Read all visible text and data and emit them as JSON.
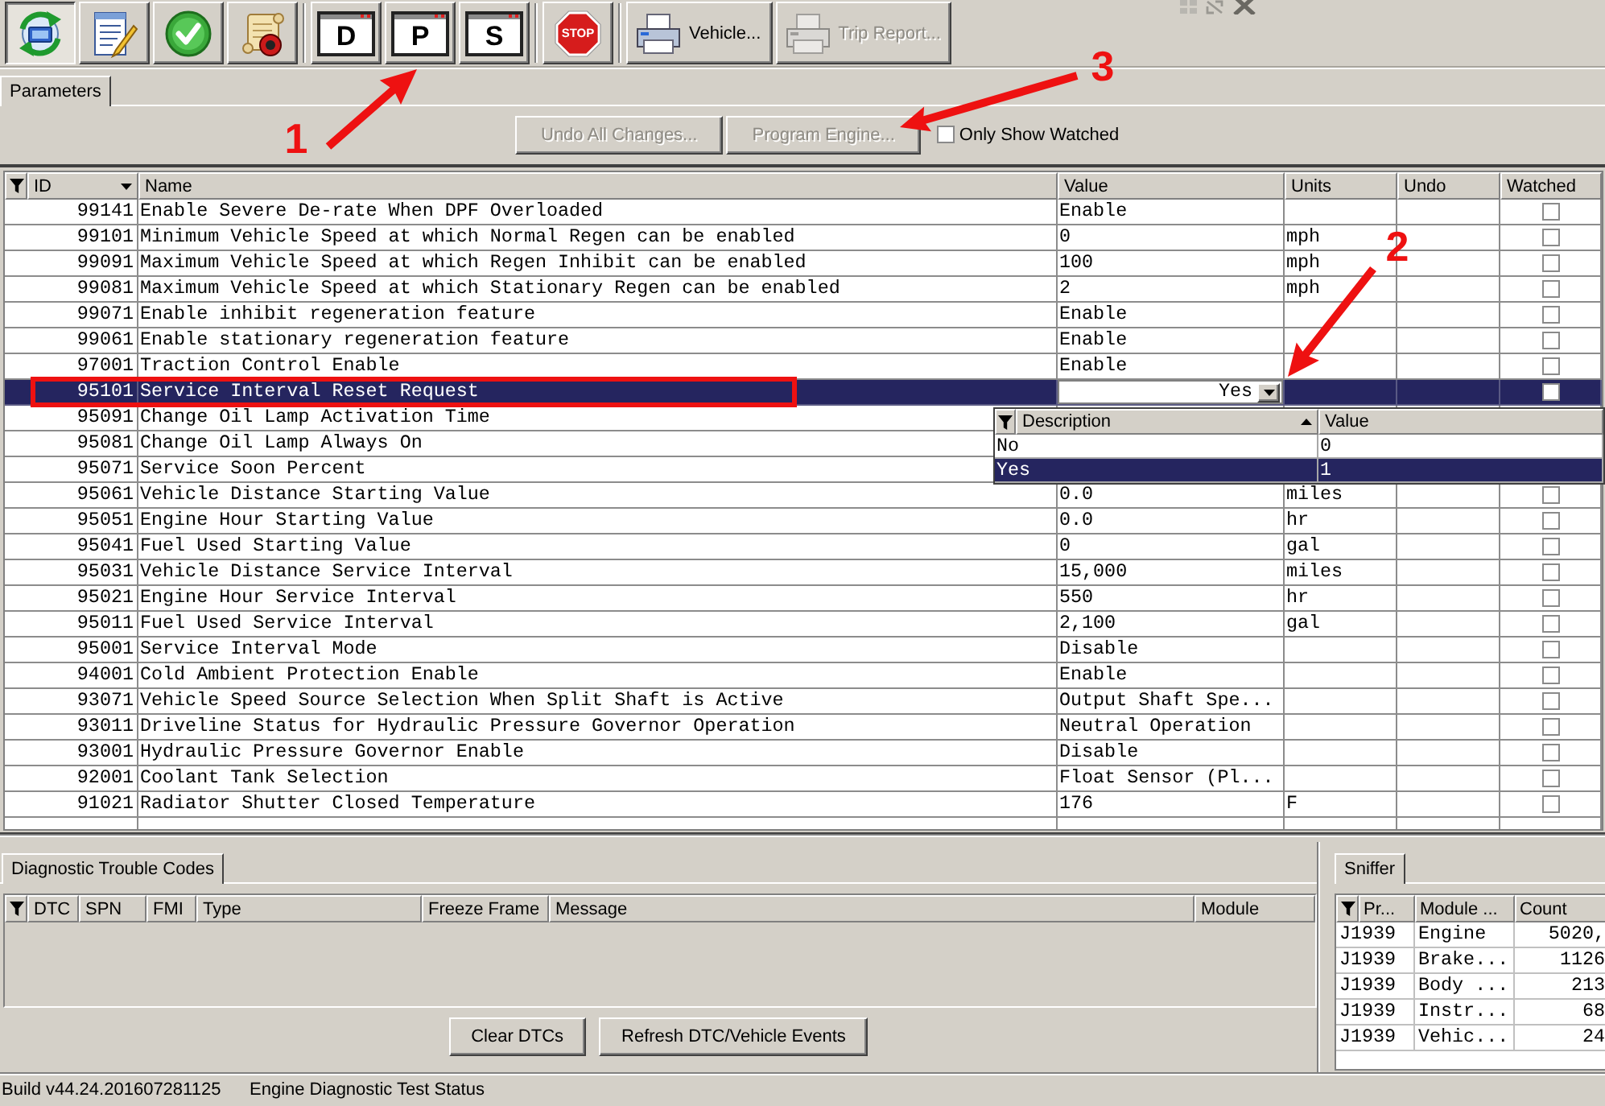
{
  "toolbar": {
    "groups": [
      [
        {
          "kind": "connect",
          "pressed": true,
          "disabled": false
        },
        {
          "kind": "edit",
          "pressed": false,
          "disabled": false
        },
        {
          "kind": "approve",
          "pressed": false,
          "disabled": false
        },
        {
          "kind": "script",
          "pressed": false,
          "disabled": false
        }
      ],
      [
        {
          "kind": "letter",
          "label": "D",
          "pressed": false,
          "disabled": false
        },
        {
          "kind": "letter",
          "label": "P",
          "pressed": false,
          "disabled": false
        },
        {
          "kind": "letter",
          "label": "S",
          "pressed": false,
          "disabled": false
        }
      ],
      [
        {
          "kind": "stop",
          "label": "STOP",
          "pressed": false,
          "disabled": false
        }
      ],
      [
        {
          "kind": "print",
          "label": "Vehicle...",
          "pressed": false,
          "disabled": false
        },
        {
          "kind": "print",
          "label": "Trip Report...",
          "pressed": false,
          "disabled": true
        }
      ]
    ]
  },
  "tabs": [
    {
      "label": "Parameters",
      "selected": true
    }
  ],
  "actions": {
    "buttons": [
      {
        "label": "Undo All Changes...",
        "disabled": true
      },
      {
        "label": "Program Engine...",
        "disabled": true
      }
    ],
    "filter": {
      "label": "Only Show Watched",
      "checked": false
    }
  },
  "table": {
    "columns": [
      {
        "label": "ID",
        "sorted_descending": true
      },
      {
        "label": "Name"
      },
      {
        "label": "Value"
      },
      {
        "label": "Units"
      },
      {
        "label": "Undo"
      },
      {
        "label": "Watched"
      }
    ],
    "rows": [
      {
        "id": "99141",
        "name": "Enable Severe De-rate When DPF Overloaded",
        "value": "Enable",
        "watched": false,
        "selected": false
      },
      {
        "id": "99101",
        "name": "Minimum Vehicle Speed at which Normal Regen can be enabled",
        "value": "0",
        "units": "mph",
        "watched": false,
        "selected": false
      },
      {
        "id": "99091",
        "name": "Maximum Vehicle Speed at which Regen Inhibit can be enabled",
        "value": "100",
        "units": "mph",
        "watched": false,
        "selected": false
      },
      {
        "id": "99081",
        "name": "Maximum Vehicle Speed at which Stationary Regen can be enabled",
        "value": "2",
        "units": "mph",
        "watched": false,
        "selected": false
      },
      {
        "id": "99071",
        "name": "Enable inhibit regeneration feature",
        "value": "Enable",
        "watched": false,
        "selected": false
      },
      {
        "id": "99061",
        "name": "Enable stationary regeneration feature",
        "value": "Enable",
        "watched": false,
        "selected": false
      },
      {
        "id": "97001",
        "name": "Traction Control Enable",
        "value": "Enable",
        "watched": false,
        "selected": false
      },
      {
        "id": "95101",
        "name": "Service Interval Reset Request",
        "value": "Yes",
        "watched": false,
        "selected": true
      },
      {
        "id": "95091",
        "name": "Change Oil Lamp Activation Time",
        "selected": false
      },
      {
        "id": "95081",
        "name": "Change Oil Lamp Always On",
        "selected": false
      },
      {
        "id": "95071",
        "name": "Service Soon Percent",
        "selected": false
      },
      {
        "id": "95061",
        "name": "Vehicle Distance Starting Value",
        "value": "0.0",
        "units": "miles",
        "watched": false,
        "selected": false
      },
      {
        "id": "95051",
        "name": "Engine Hour Starting Value",
        "value": "0.0",
        "units": "hr",
        "watched": false,
        "selected": false
      },
      {
        "id": "95041",
        "name": "Fuel Used Starting Value",
        "value": "0",
        "units": "gal",
        "watched": false,
        "selected": false
      },
      {
        "id": "95031",
        "name": "Vehicle Distance Service Interval",
        "value": "15,000",
        "units": "miles",
        "watched": false,
        "selected": false
      },
      {
        "id": "95021",
        "name": "Engine Hour Service Interval",
        "value": "550",
        "units": "hr",
        "watched": false,
        "selected": false
      },
      {
        "id": "95011",
        "name": "Fuel Used Service Interval",
        "value": "2,100",
        "units": "gal",
        "watched": false,
        "selected": false
      },
      {
        "id": "95001",
        "name": "Service Interval Mode",
        "value": "Disable",
        "watched": false,
        "selected": false
      },
      {
        "id": "94001",
        "name": "Cold Ambient Protection Enable",
        "value": "Enable",
        "watched": false,
        "selected": false
      },
      {
        "id": "93071",
        "name": "Vehicle Speed Source Selection When Split Shaft is Active",
        "value": "Output Shaft Spe...",
        "watched": false,
        "selected": false
      },
      {
        "id": "93011",
        "name": "Driveline Status for Hydraulic Pressure Governor Operation",
        "value": "Neutral Operation",
        "watched": false,
        "selected": false
      },
      {
        "id": "93001",
        "name": "Hydraulic Pressure Governor Enable",
        "value": "Disable",
        "watched": false,
        "selected": false
      },
      {
        "id": "92001",
        "name": "Coolant Tank Selection",
        "value": "Float Sensor (Pl...",
        "watched": false,
        "selected": false
      },
      {
        "id": "91021",
        "name": "Radiator Shutter Closed Temperature",
        "value": "176",
        "units": "F",
        "watched": false,
        "selected": false
      }
    ]
  },
  "value_dropdown": {
    "columns": [
      {
        "label": "Description",
        "sorted_ascending": true
      },
      {
        "label": "Value"
      }
    ],
    "options": [
      {
        "description": "No",
        "value": "0",
        "selected": false
      },
      {
        "description": "Yes",
        "value": "1",
        "selected": true
      }
    ]
  },
  "dtc_panel": {
    "tab": {
      "label": "Diagnostic Trouble Codes",
      "selected": true
    },
    "columns": [
      "DTC",
      "SPN",
      "FMI",
      "Type",
      "Freeze Frame",
      "Message",
      "Module"
    ],
    "buttons": [
      "Clear DTCs",
      "Refresh DTC/Vehicle Events"
    ]
  },
  "sniffer": {
    "tab": {
      "label": "Sniffer",
      "selected": true
    },
    "columns": [
      "Pr...",
      "Module ...",
      "Count"
    ],
    "rows": [
      {
        "protocol": "J1939",
        "module": "Engine",
        "count": "5020,"
      },
      {
        "protocol": "J1939",
        "module": "Brake...",
        "count": "1126"
      },
      {
        "protocol": "J1939",
        "module": "Body ...",
        "count": "213"
      },
      {
        "protocol": "J1939",
        "module": "Instr...",
        "count": "68"
      },
      {
        "protocol": "J1939",
        "module": "Vehic...",
        "count": "24"
      }
    ]
  },
  "status_bar": [
    "Build v44.24.201607281125",
    "Engine Diagnostic Test Status"
  ],
  "annotations": [
    {
      "kind": "arrow",
      "label": "1"
    },
    {
      "kind": "arrow",
      "label": "2"
    },
    {
      "kind": "arrow",
      "label": "3"
    },
    {
      "kind": "box"
    }
  ]
}
